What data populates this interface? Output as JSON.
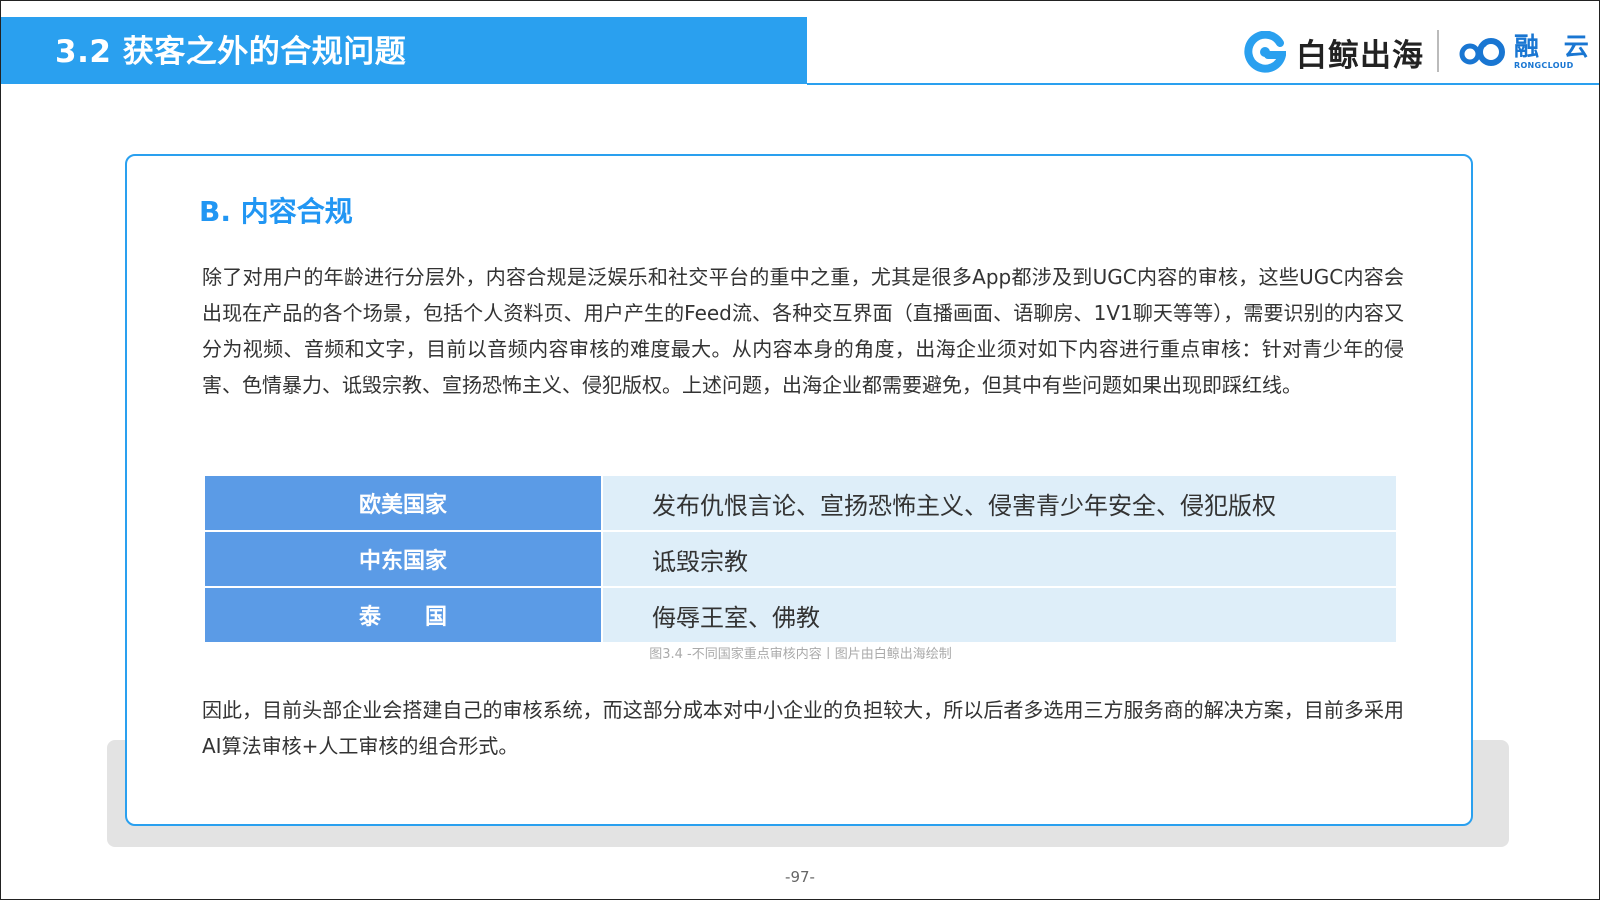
{
  "header": {
    "title": "3.2 获客之外的合规问题",
    "brand_primary": "白鲸出海",
    "brand_secondary_cn": "融 云",
    "brand_secondary_en": "RONGCLOUD",
    "accent_color": "#2aa0ef"
  },
  "section": {
    "title": "B. 内容合规",
    "intro": "除了对用户的年龄进行分层外，内容合规是泛娱乐和社交平台的重中之重，尤其是很多App都涉及到UGC内容的审核，这些UGC内容会出现在产品的各个场景，包括个人资料页、用户产生的Feed流、各种交互界面（直播画面、语聊房、1V1聊天等等），需要识别的内容又分为视频、音频和文字，目前以音频内容审核的难度最大。从内容本身的角度，出海企业须对如下内容进行重点审核：针对青少年的侵害、色情暴力、诋毁宗教、宣扬恐怖主义、侵犯版权。上述问题，出海企业都需要避免，但其中有些问题如果出现即踩红线。",
    "conclusion": "因此，目前头部企业会搭建自己的审核系统，而这部分成本对中小企业的负担较大，所以后者多选用三方服务商的解决方案，目前多采用AI算法审核+人工审核的组合形式。"
  },
  "table": {
    "rows": [
      {
        "region": "欧美国家",
        "content": "发布仇恨言论、宣扬恐怖主义、侵害青少年安全、侵犯版权"
      },
      {
        "region": "中东国家",
        "content": "诋毁宗教"
      },
      {
        "region": "泰　　国",
        "content": "侮辱王室、佛教"
      }
    ],
    "caption": "图3.4 -不同国家重点审核内容丨图片由白鲸出海绘制"
  },
  "footer": {
    "page_number": "-97-"
  }
}
